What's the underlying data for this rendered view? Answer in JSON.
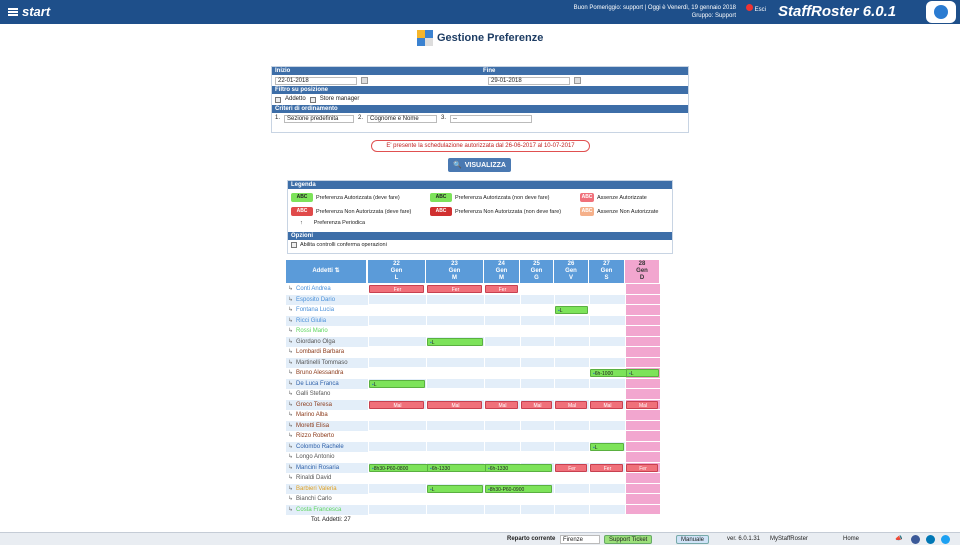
{
  "topbar": {
    "app": "start",
    "greeting": "Buon Pomeriggio: support | Oggi è Venerdì, 19 gennaio 2018",
    "group": "Gruppo: Support",
    "exit": "Esci",
    "brand": "StaffRoster 6.0.1"
  },
  "page_title": "Gestione Preferenze",
  "filters": {
    "inizio_label": "Inizio",
    "fine_label": "Fine",
    "inizio_value": "22-01-2018",
    "fine_value": "29-01-2018",
    "filtro_label": "Filtro su posizione",
    "pos1": "Addetto",
    "pos2": "Store manager",
    "criteri_label": "Criteri di ordinamento",
    "c1_num": "1.",
    "c1": "Sezione predefinita",
    "c2_num": "2.",
    "c2": "Cognome e Nome",
    "c3_num": "3.",
    "c3": "--"
  },
  "schedule_notice": "E' presente la schedulazione autorizzata dal 26-06-2017 al 10-07-2017",
  "visualizza": "VISUALIZZA",
  "legend": {
    "title": "Legenda",
    "abc": "ABC",
    "i1": "Preferenza Autorizzata (deve fare)",
    "i2": "Preferenza Autorizzata (non deve fare)",
    "i3": "Assenze Autorizzate",
    "i4": "Preferenza Non Autorizzata (deve fare)",
    "i5": "Preferenza Non Autorizzata (non deve fare)",
    "i6": "Assenze Non Autorizzate",
    "i7": "Preferenza Periodica",
    "i7_sym": "↑",
    "options_title": "Opzioni",
    "option1": "Abilita controlli conferma operazioni"
  },
  "grid": {
    "header_label": "Addetti",
    "days": [
      {
        "d": "22",
        "m": "Gen",
        "w": "L"
      },
      {
        "d": "23",
        "m": "Gen",
        "w": "M"
      },
      {
        "d": "24",
        "m": "Gen",
        "w": "M"
      },
      {
        "d": "25",
        "m": "Gen",
        "w": "G"
      },
      {
        "d": "26",
        "m": "Gen",
        "w": "V"
      },
      {
        "d": "27",
        "m": "Gen",
        "w": "S"
      },
      {
        "d": "28",
        "m": "Gen",
        "w": "D"
      }
    ],
    "rows": [
      {
        "name": "Conti Andrea",
        "color": "#4a90d9",
        "cells": {
          "0": "Fer",
          "1": "Fer",
          "2": "Fer"
        }
      },
      {
        "name": "Esposito Dario",
        "color": "#4a90d9",
        "cells": {}
      },
      {
        "name": "Fontana Lucia",
        "color": "#4a90d9",
        "cells": {
          "4": "L"
        }
      },
      {
        "name": "Ricci Giulia",
        "color": "#4a90d9",
        "cells": {}
      },
      {
        "name": "Rossi Mario",
        "color": "#5cd65c",
        "cells": {}
      },
      {
        "name": "Giordano Olga",
        "color": "#555555",
        "cells": {
          "1": "L"
        }
      },
      {
        "name": "Lombardi Barbara",
        "color": "#8b3a1a",
        "cells": {}
      },
      {
        "name": "Martinelli Tommaso",
        "color": "#555555",
        "cells": {}
      },
      {
        "name": "Bruno Alessandra",
        "color": "#8b3a1a",
        "cells": {
          "5": "6h-1000",
          "6": "L"
        }
      },
      {
        "name": "De Luca Franca",
        "color": "#2c5fa8",
        "cells": {
          "0": "L"
        }
      },
      {
        "name": "Galli Stefano",
        "color": "#555555",
        "cells": {}
      },
      {
        "name": "Greco Teresa",
        "color": "#8b3a1a",
        "cells": {
          "0": "Mal",
          "1": "Mal",
          "2": "Mal",
          "3": "Mal",
          "4": "Mal",
          "5": "Mal",
          "6": "Mal"
        }
      },
      {
        "name": "Marino Alba",
        "color": "#8b3a1a",
        "cells": {}
      },
      {
        "name": "Moretti Elisa",
        "color": "#8b3a1a",
        "cells": {}
      },
      {
        "name": "Rizzo Roberto",
        "color": "#8b3a1a",
        "cells": {}
      },
      {
        "name": "Colombo Rachele",
        "color": "#2c5fa8",
        "cells": {
          "5": "L"
        }
      },
      {
        "name": "Longo Antonio",
        "color": "#555555",
        "cells": {}
      },
      {
        "name": "Mancini Rosaria",
        "color": "#2c5fa8",
        "cells": {
          "0": "8h30-P60-0800",
          "1": "6h-1330",
          "2": "6h-1330",
          "4": "Fer",
          "5": "Fer",
          "6": "Fer"
        }
      },
      {
        "name": "Rinaldi David",
        "color": "#555555",
        "cells": {}
      },
      {
        "name": "Barbieri Valeria",
        "color": "#e0a020",
        "cells": {
          "1": "L",
          "2": "8h30-P60-0900"
        }
      },
      {
        "name": "Bianchi Carlo",
        "color": "#555555",
        "cells": {}
      },
      {
        "name": "Costa Francesca",
        "color": "#5cd65c",
        "cells": {}
      }
    ],
    "total": "Tot. Addetti: 27"
  },
  "bottombar": {
    "reparto_label": "Reparto corrente",
    "reparto": "Firenze",
    "support": "Support Ticket",
    "manuale": "Manuale",
    "version": "ver. 6.0.1.31",
    "my": "MyStaffRoster",
    "home": "Home"
  },
  "colors": {
    "accent": "#1e4f8a",
    "green": "#7de35a",
    "red": "#f0707a",
    "pink": "#f2a6cf"
  }
}
